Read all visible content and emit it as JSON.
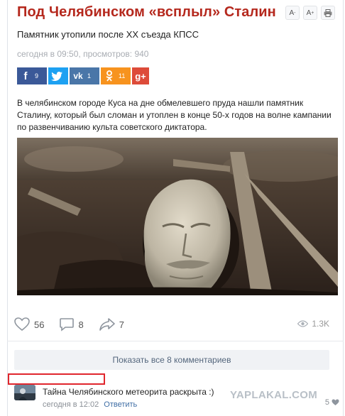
{
  "article": {
    "title": "Под Челябинском «всплыл» Сталин",
    "subtitle": "Памятник утопили после XX съезда КПСС",
    "meta": "сегодня в 09:50, просмотров: 940",
    "body": "В челябинском городе Куса на дне обмелевшего пруда нашли памятник Сталину, который был сломан и утоплен в конце 50-х годов на волне кампании по развенчиванию культа советского диктатора."
  },
  "tools": {
    "font_smaller": "A",
    "font_larger": "A",
    "minus": "-",
    "plus": "+",
    "print_icon": "printer-icon"
  },
  "share": {
    "facebook_count": "9",
    "vk_count": "1",
    "ok_count": "11",
    "colors": {
      "facebook": "#3b5998",
      "twitter": "#1da1f2",
      "vk": "#4a76a8",
      "ok": "#f7931e",
      "gplus": "#dd4b39"
    }
  },
  "stats": {
    "likes": "56",
    "comments": "8",
    "reposts": "7",
    "views": "1.3K"
  },
  "comments_section": {
    "show_all_label": "Показать все 8 комментариев",
    "comment": {
      "text": "Тайна Челябинского метеорита раскрыта :)",
      "time": "сегодня в 12:02",
      "reply_label": "Ответить",
      "likes": "5"
    }
  },
  "watermark": "YAPLAKAL.COM",
  "accent_color": "#b5281d",
  "highlight_color": "#e0262d"
}
